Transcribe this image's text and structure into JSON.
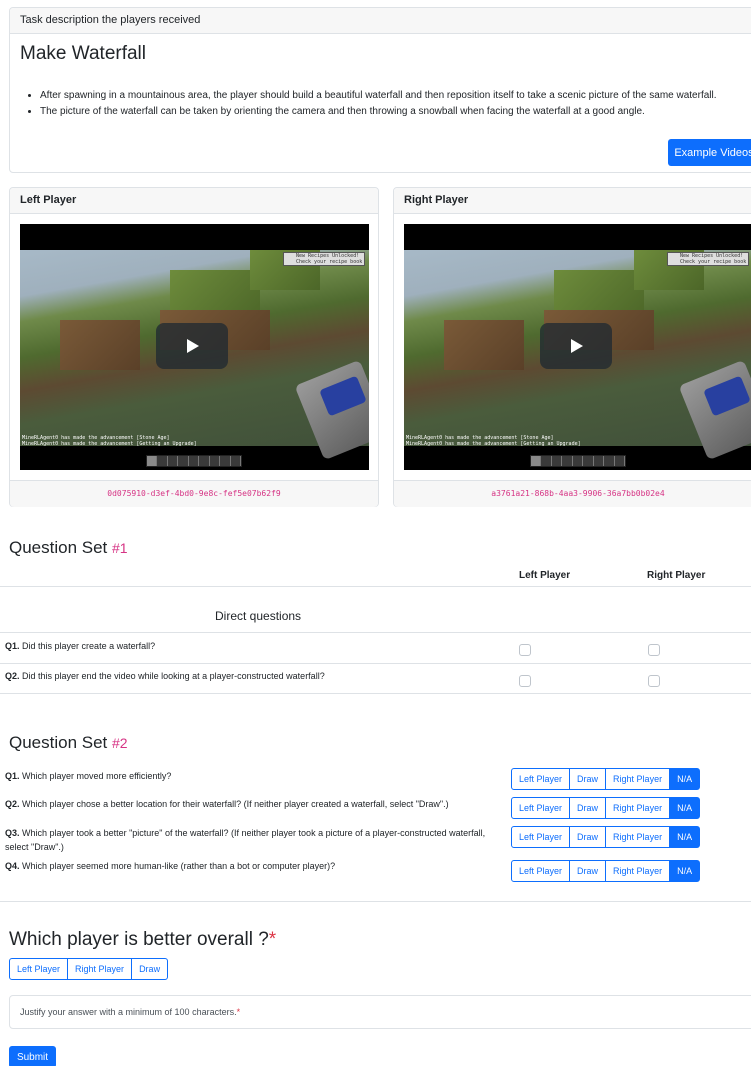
{
  "task": {
    "header": "Task description the players received",
    "title": "Make Waterfall",
    "bullets": [
      "After spawning in a mountainous area, the player should build a beautiful waterfall and then reposition itself to take a scenic picture of the same waterfall.",
      "The picture of the waterfall can be taken by orienting the camera and then throwing a snowball when facing the waterfall at a good angle."
    ],
    "example_button": "Example Videos"
  },
  "players": {
    "left": {
      "header": "Left Player",
      "video_id": "0d075910-d3ef-4bd0-9e8c-fef5e07b62f9",
      "toast": [
        "New Recipes Unlocked!",
        "Check your recipe book"
      ],
      "chat": [
        "MineRLAgent0 has made the advancement [Stone Age]",
        "MineRLAgent0 has made the advancement [Getting an Upgrade]"
      ]
    },
    "right": {
      "header": "Right Player",
      "video_id": "a3761a21-868b-4aa3-9906-36a7bb0b02e4",
      "toast": [
        "New Recipes Unlocked!",
        "Check your recipe book"
      ],
      "chat": [
        "MineRLAgent0 has made the advancement [Stone Age]",
        "MineRLAgent0 has made the advancement [Getting an Upgrade]"
      ]
    }
  },
  "qset1": {
    "title": "Question Set",
    "number": "#1",
    "col_left": "Left Player",
    "col_right": "Right Player",
    "group_label": "Direct questions",
    "questions": [
      {
        "num": "Q1.",
        "text": "Did this player create a waterfall?"
      },
      {
        "num": "Q2.",
        "text": "Did this player end the video while looking at a player-constructed waterfall?"
      }
    ]
  },
  "qset2": {
    "title": "Question Set",
    "number": "#2",
    "options": [
      "Left Player",
      "Draw",
      "Right Player",
      "N/A"
    ],
    "selected": "N/A",
    "questions": [
      {
        "num": "Q1.",
        "text": "Which player moved more efficiently?"
      },
      {
        "num": "Q2.",
        "text": "Which player chose a better location for their waterfall? (If neither player created a waterfall, select \"Draw\".)"
      },
      {
        "num": "Q3.",
        "text": "Which player took a better \"picture\" of the waterfall? (If neither player took a picture of a player-constructed waterfall, select \"Draw\".)"
      },
      {
        "num": "Q4.",
        "text": "Which player seemed more human-like (rather than a bot or computer player)?"
      }
    ]
  },
  "overall": {
    "title": "Which player is better overall ?",
    "required_mark": "*",
    "options": [
      "Left Player",
      "Right Player",
      "Draw"
    ],
    "justify_placeholder": "Justify your answer with a minimum of 100 characters.",
    "submit": "Submit"
  },
  "colors": {
    "primary": "#0d6efd",
    "code_pink": "#d63384",
    "required": "#dc3545"
  }
}
